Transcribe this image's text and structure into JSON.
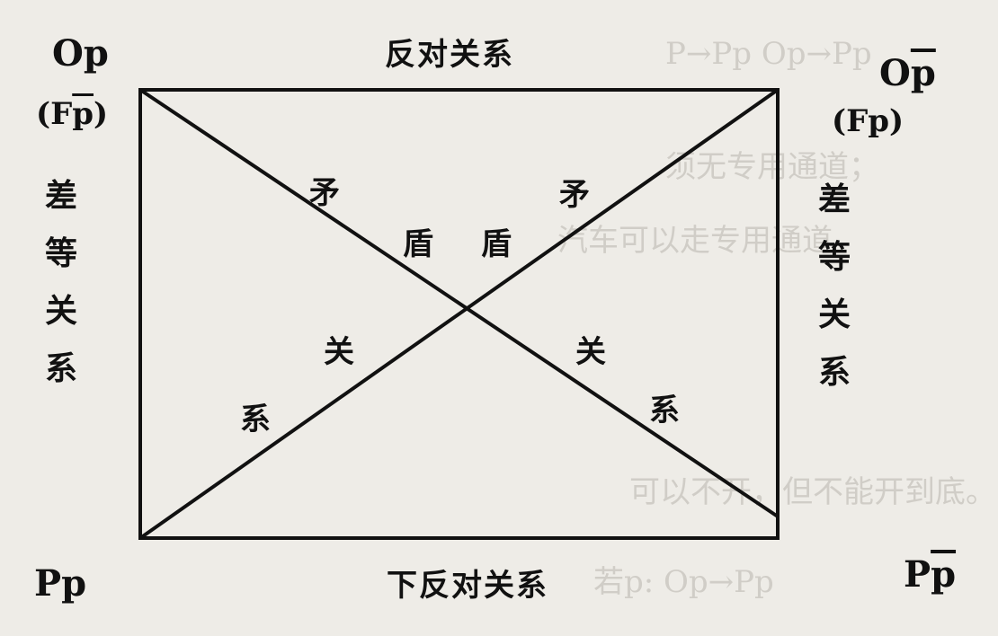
{
  "corners": {
    "top_left": {
      "main": "Op",
      "sub_prefix": "(F",
      "sub_bar": "p",
      "sub_suffix": ")"
    },
    "top_right": {
      "main_prefix": "O",
      "main_bar": "p",
      "sub": "(Fp)"
    },
    "bottom_left": {
      "main": "Pp"
    },
    "bottom_right": {
      "main_prefix": "P",
      "main_bar": "p"
    }
  },
  "edges": {
    "top": "反对关系",
    "bottom": "下反对关系",
    "left_chars": [
      "差",
      "等",
      "关",
      "系"
    ],
    "right_chars": [
      "差",
      "等",
      "关",
      "系"
    ]
  },
  "diagonals": {
    "left_chars": [
      "矛",
      "盾",
      "关",
      "系"
    ],
    "right_chars": [
      "矛",
      "盾",
      "关",
      "系"
    ]
  },
  "background_ghost": {
    "line1": "P→Pp   Op→Pp",
    "line2": "须无专用通道；",
    "line3": "汽车可以走专用通道。",
    "line4": "可以不开，但不能开到底。",
    "line5": "若p: Op→Pp"
  },
  "colors": {
    "ink": "#111111",
    "paper": "#eeece7",
    "ghost": "#b9b5ad"
  }
}
